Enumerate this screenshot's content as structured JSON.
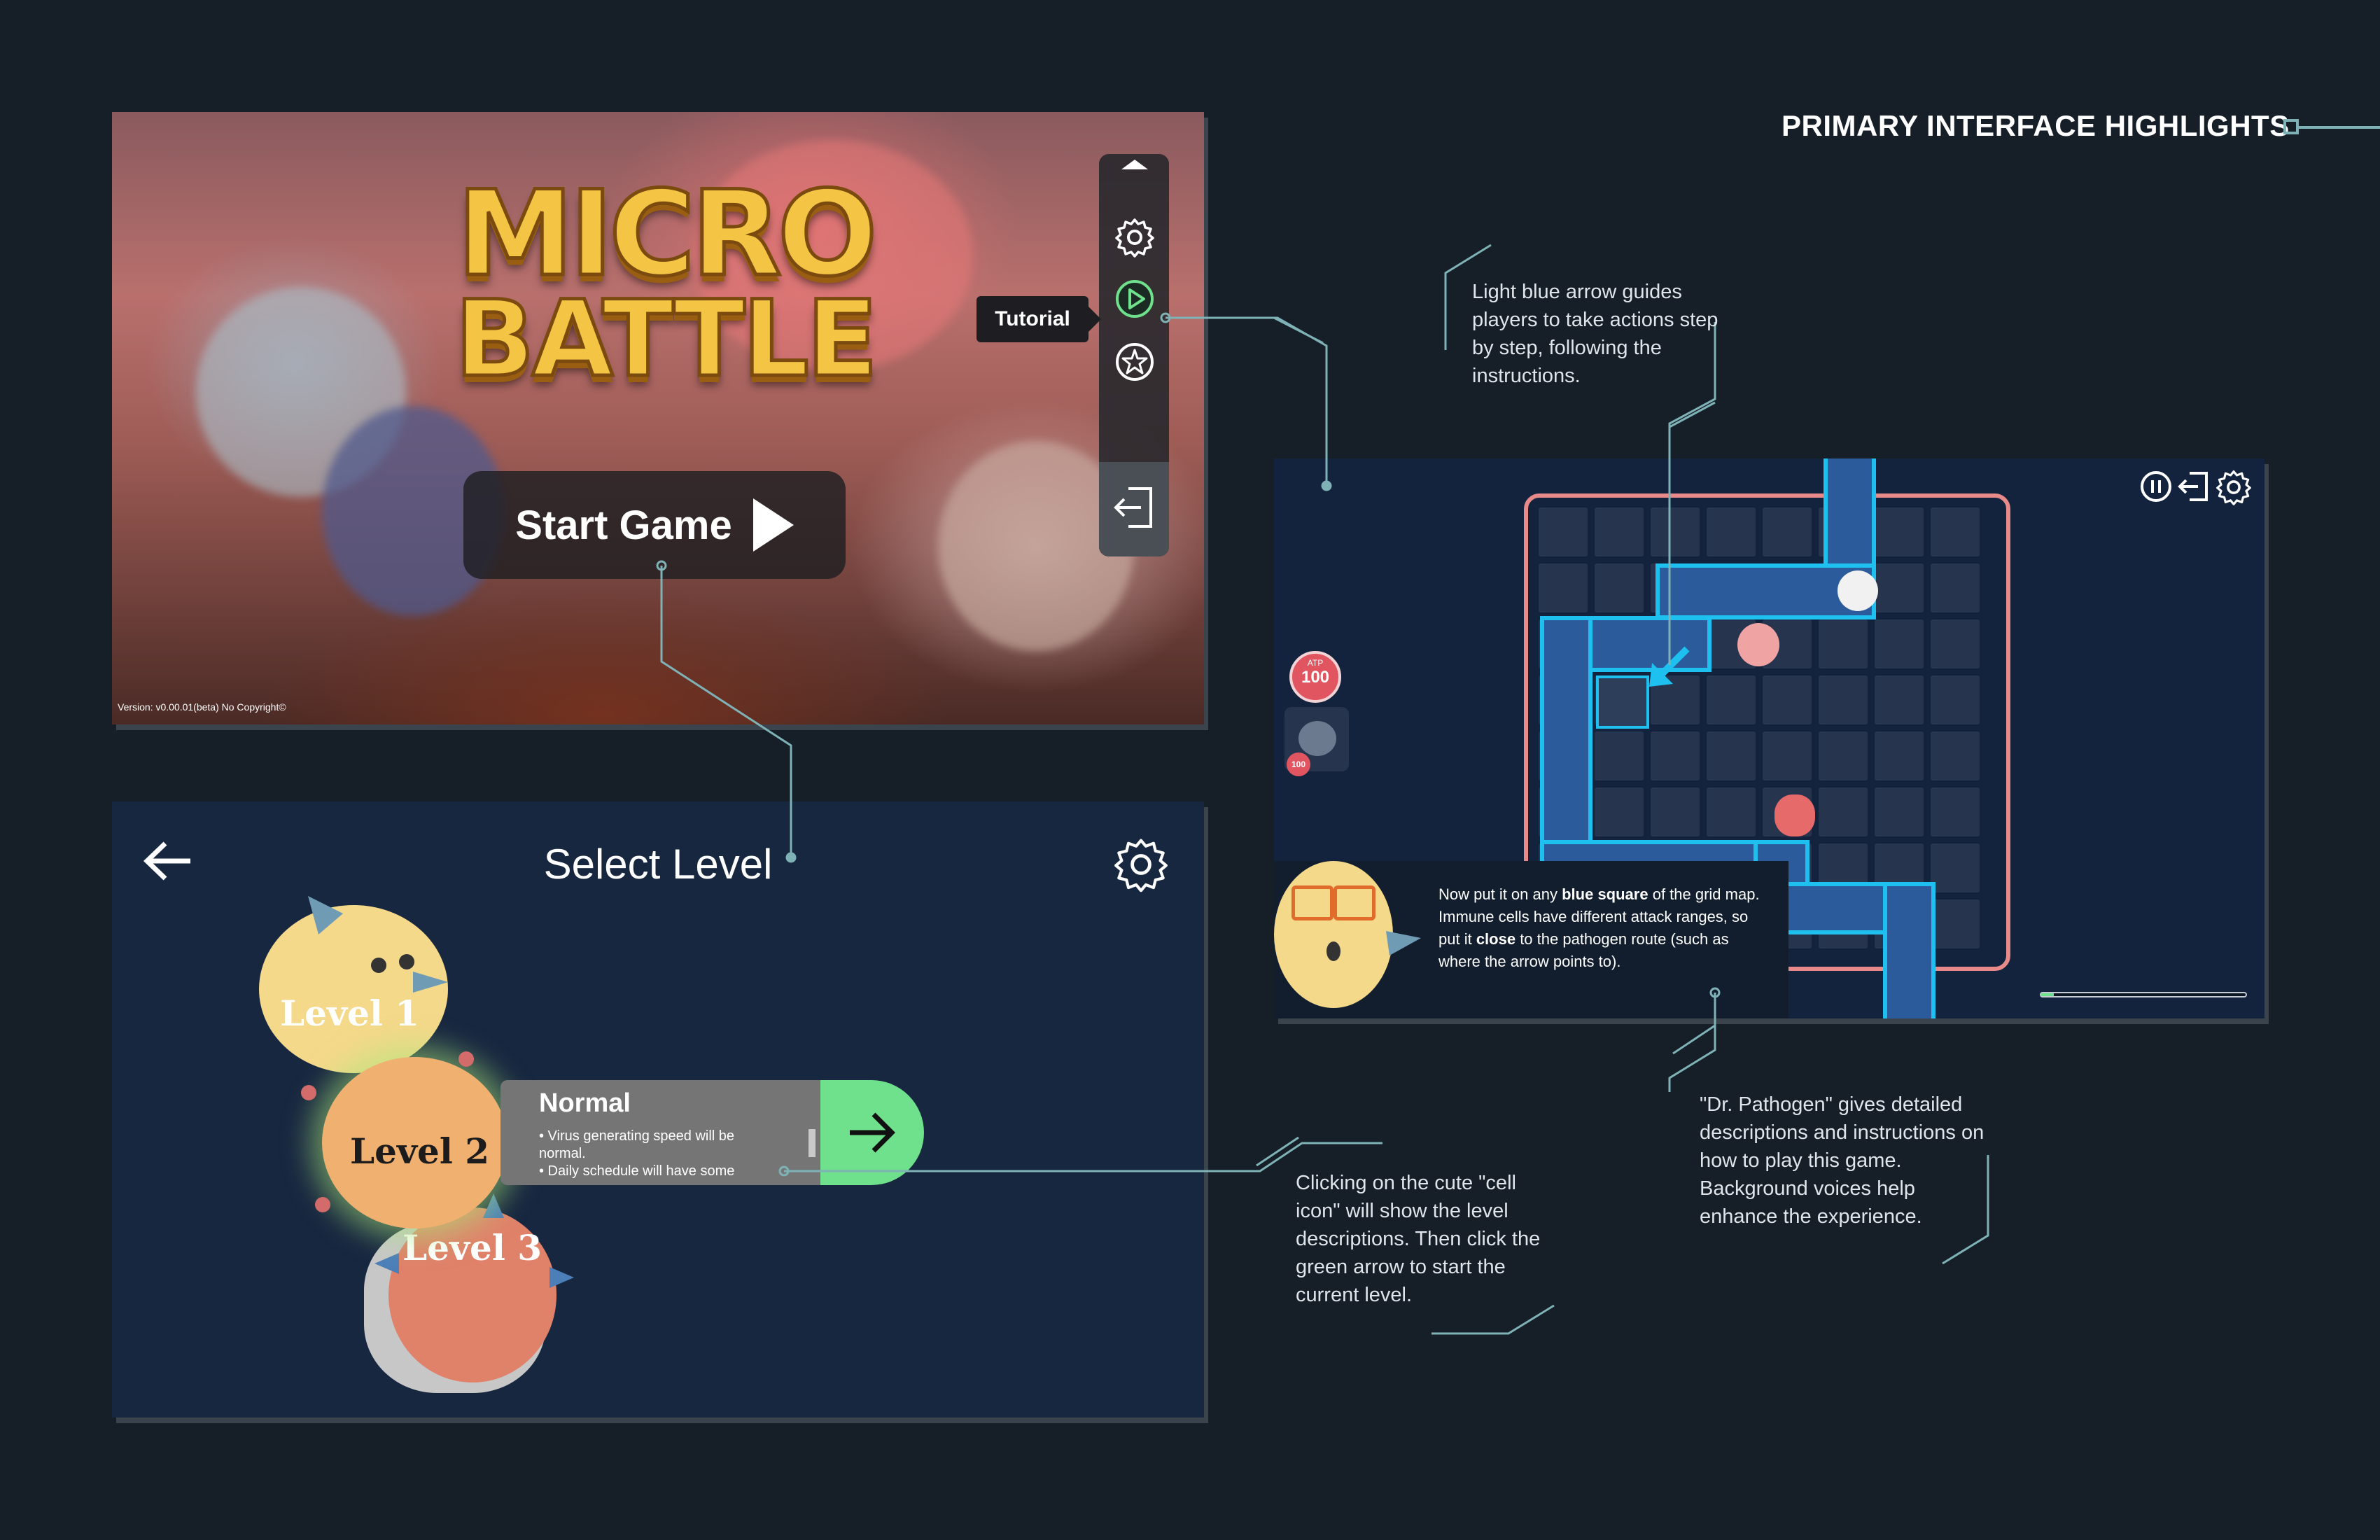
{
  "header": {
    "title": "PRIMARY INTERFACE HIGHLIGHTS"
  },
  "title_screen": {
    "logo_line1": "MICRO",
    "logo_line2": "BATTLE",
    "start_label": "Start Game",
    "version": "Version: v0.00.01(beta) No Copyright©",
    "tutorial_tooltip": "Tutorial",
    "rail_icons": [
      "chevron-up-icon",
      "gear-icon",
      "play-circle-icon",
      "star-badge-icon",
      "exit-icon"
    ]
  },
  "level_select": {
    "title": "Select Level",
    "levels": [
      "Level 1",
      "Level 2",
      "Level 3"
    ],
    "selected_desc": {
      "title": "Normal",
      "line1": "• Virus generating speed will be normal.",
      "line2": "• Daily schedule will have some"
    }
  },
  "gameplay": {
    "atp_label": "ATP",
    "atp_value": "100",
    "unit_cost": "100",
    "dialog_parts": [
      {
        "t": "Now put it on any ",
        "b": false
      },
      {
        "t": "blue square",
        "b": true
      },
      {
        "t": " of the grid map. Immune cells have different attack ranges, so put it ",
        "b": false
      },
      {
        "t": "close",
        "b": true
      },
      {
        "t": " to the pathogen route (such as where the arrow points to).",
        "b": false
      }
    ],
    "progress": 0.06,
    "top_icons": [
      "pause-icon",
      "exit-icon",
      "gear-icon"
    ]
  },
  "annotations": {
    "arrow_note": "Light blue arrow guides players to take actions step by step, following the instructions.",
    "cell_note": "Clicking on the cute \"cell icon\" will show the level descriptions. Then click the green arrow to start the current level.",
    "pathogen_note": "\"Dr. Pathogen\" gives detailed descriptions and instructions on how to play this game. Background voices help enhance the experience."
  },
  "colors": {
    "background": "#161e28",
    "accent_teal": "#7fb2b6",
    "go_green": "#6fe08b",
    "path_blue": "#1dc0ee",
    "zone_pink": "#e88a8a",
    "atp_red": "#e05560"
  }
}
